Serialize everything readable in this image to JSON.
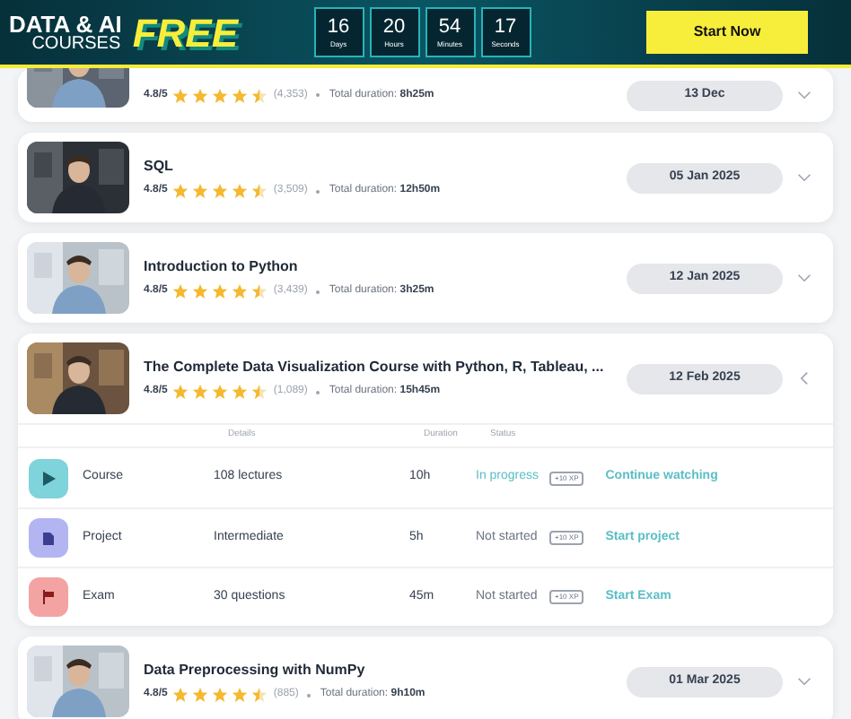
{
  "banner": {
    "headline_1": "DATA & AI",
    "headline_2": "COURSES",
    "highlight": "FREE",
    "countdown": [
      {
        "value": "16",
        "unit": "Days"
      },
      {
        "value": "20",
        "unit": "Hours"
      },
      {
        "value": "54",
        "unit": "Minutes"
      },
      {
        "value": "17",
        "unit": "Seconds"
      }
    ],
    "button": "Start Now"
  },
  "courses": [
    {
      "rating": "4.8/5",
      "stars": 4.5,
      "reviews": "(4,353)",
      "duration_label": "Total duration:",
      "duration": "8h25m",
      "date": "13 Dec",
      "expanded": false
    },
    {
      "title": "SQL",
      "rating": "4.8/5",
      "stars": 4.5,
      "reviews": "(3,509)",
      "duration_label": "Total duration:",
      "duration": "12h50m",
      "date": "05 Jan 2025",
      "expanded": false
    },
    {
      "title": "Introduction to Python",
      "rating": "4.8/5",
      "stars": 4.5,
      "reviews": "(3,439)",
      "duration_label": "Total duration:",
      "duration": "3h25m",
      "date": "12 Jan 2025",
      "expanded": false
    },
    {
      "title": "The Complete Data Visualization Course with Python, R, Tableau, ...",
      "rating": "4.8/5",
      "stars": 4.5,
      "reviews": "(1,089)",
      "duration_label": "Total duration:",
      "duration": "15h45m",
      "date": "12 Feb 2025",
      "expanded": true,
      "columns": [
        "Details",
        "Duration",
        "Status"
      ],
      "parts": [
        {
          "kind": "course",
          "name": "Course",
          "details": "108 lectures",
          "duration": "10h",
          "status": "In progress",
          "in_progress": true,
          "xp": "+10 XP",
          "action": "Continue watching"
        },
        {
          "kind": "project",
          "name": "Project",
          "details": "Intermediate",
          "duration": "5h",
          "status": "Not started",
          "in_progress": false,
          "xp": "+10 XP",
          "action": "Start project"
        },
        {
          "kind": "exam",
          "name": "Exam",
          "details": "30 questions",
          "duration": "45m",
          "status": "Not started",
          "in_progress": false,
          "xp": "+10 XP",
          "action": "Start Exam"
        }
      ]
    },
    {
      "title": "Data Preprocessing with NumPy",
      "rating": "4.8/5",
      "stars": 4.5,
      "reviews": "(885)",
      "duration_label": "Total duration:",
      "duration": "9h10m",
      "date": "01 Mar 2025",
      "expanded": false
    }
  ]
}
